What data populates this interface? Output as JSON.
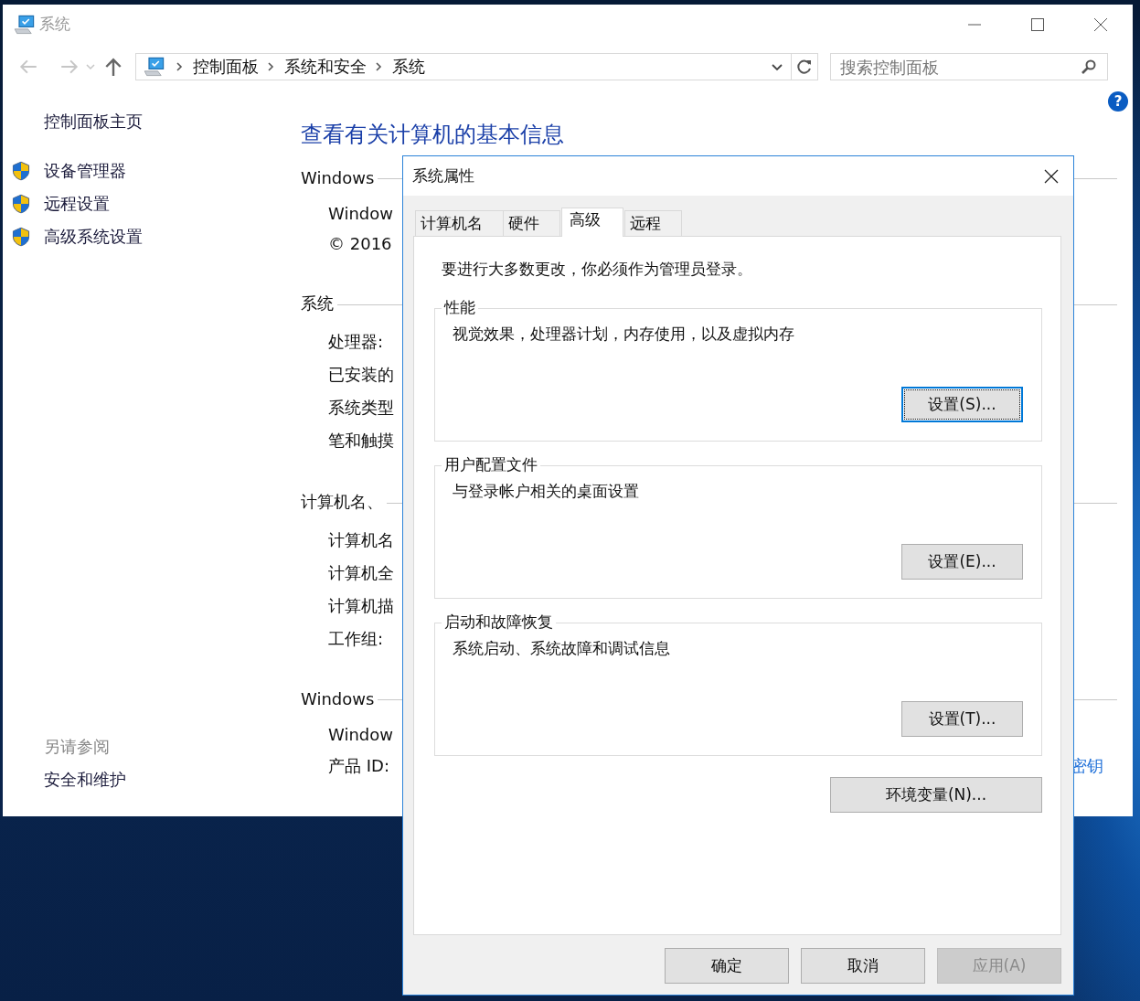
{
  "window": {
    "title": "系统"
  },
  "address_bar": {
    "crumbs": [
      "控制面板",
      "系统和安全",
      "系统"
    ]
  },
  "search": {
    "placeholder": "搜索控制面板"
  },
  "help": {
    "glyph": "?"
  },
  "sidebar": {
    "home": "控制面板主页",
    "items": [
      {
        "label": "设备管理器"
      },
      {
        "label": "远程设置"
      },
      {
        "label": "高级系统设置"
      }
    ],
    "see_also_heading": "另请参阅",
    "see_also": [
      "安全和维护"
    ]
  },
  "content": {
    "heading": "查看有关计算机的基本信息",
    "sections": [
      {
        "title": "Windows",
        "rows": [
          {
            "label": "Window"
          },
          {
            "label": "© 2016"
          }
        ]
      },
      {
        "title": "系统",
        "rows": [
          {
            "label": "处理器:"
          },
          {
            "label": "已安装的"
          },
          {
            "label": "系统类型"
          },
          {
            "label": "笔和触摸"
          }
        ]
      },
      {
        "title": "计算机名、",
        "rows": [
          {
            "label": "计算机名"
          },
          {
            "label": "计算机全"
          },
          {
            "label": "计算机描"
          },
          {
            "label": "工作组:"
          }
        ]
      },
      {
        "title": "Windows",
        "rows": [
          {
            "label": "Window"
          },
          {
            "label": "产品 ID:",
            "link": "密钥"
          }
        ]
      }
    ]
  },
  "dialog": {
    "title": "系统属性",
    "tabs": [
      {
        "label": "计算机名",
        "selected": false
      },
      {
        "label": "硬件",
        "selected": false
      },
      {
        "label": "高级",
        "selected": true
      },
      {
        "label": "远程",
        "selected": false
      }
    ],
    "notice": "要进行大多数更改，你必须作为管理员登录。",
    "groups": [
      {
        "title": "性能",
        "description": "视觉效果，处理器计划，内存使用，以及虚拟内存",
        "button": {
          "label": "设置(S)...",
          "focused": true
        }
      },
      {
        "title": "用户配置文件",
        "description": "与登录帐户相关的桌面设置",
        "button": {
          "label": "设置(E)...",
          "focused": false
        }
      },
      {
        "title": "启动和故障恢复",
        "description": "系统启动、系统故障和调试信息",
        "button": {
          "label": "设置(T)...",
          "focused": false
        }
      }
    ],
    "env_button": {
      "label": "环境变量(N)..."
    },
    "buttons": [
      {
        "label": "确定",
        "disabled": false
      },
      {
        "label": "取消",
        "disabled": false
      },
      {
        "label": "应用(A)",
        "disabled": true
      }
    ]
  }
}
